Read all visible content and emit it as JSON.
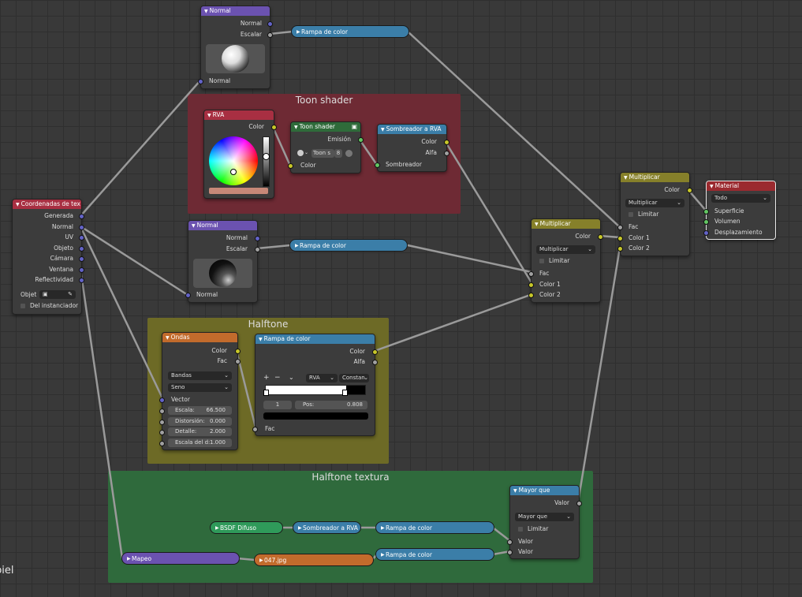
{
  "frames": {
    "toon": {
      "title": "Toon shader",
      "color": "#6e2a34"
    },
    "halftone": {
      "title": "Halftone",
      "color": "#6d6a26"
    },
    "halftone_tex": {
      "title": "Halftone textura",
      "color": "#2f6a3c"
    }
  },
  "normal_top": {
    "title": "Normal",
    "out_normal": "Normal",
    "out_scalar": "Escalar",
    "in_normal": "Normal"
  },
  "normal_mid": {
    "title": "Normal",
    "out_normal": "Normal",
    "out_scalar": "Escalar",
    "in_normal": "Normal"
  },
  "ramp_pills": {
    "r1": "Rampa de color",
    "r2": "Rampa de color",
    "r3": "Rampa de color",
    "r4": "Rampa de color"
  },
  "rva": {
    "title": "RVA",
    "out": "Color"
  },
  "toon_node": {
    "title": "Toon shader",
    "out": "Emisión",
    "mode": "Toon s",
    "value": "8",
    "in": "Color"
  },
  "shader_rgb": {
    "title": "Sombreador a RVA",
    "out_color": "Color",
    "out_alpha": "Alfa",
    "in": "Sombreador"
  },
  "texcoord": {
    "title": "Coordenadas de tex",
    "outputs": [
      "Generada",
      "Normal",
      "UV",
      "Objeto",
      "Cámara",
      "Ventana",
      "Reflectividad"
    ],
    "object_label": "Objet",
    "instancer": "Del instanciador"
  },
  "mult1": {
    "title": "Multiplicar",
    "out": "Color",
    "mode": "Multiplicar",
    "clamp": "Limitar",
    "in_fac": "Fac",
    "in_c1": "Color 1",
    "in_c2": "Color 2"
  },
  "mult2": {
    "title": "Multiplicar",
    "out": "Color",
    "mode": "Multiplicar",
    "clamp": "Limitar",
    "in_fac": "Fac",
    "in_c1": "Color 1",
    "in_c2": "Color 2"
  },
  "material": {
    "title": "Material",
    "target": "Todo",
    "inputs": [
      "Superficie",
      "Volumen",
      "Desplazamiento"
    ]
  },
  "waves": {
    "title": "Ondas",
    "out_color": "Color",
    "out_fac": "Fac",
    "type": "Bandas",
    "profile": "Seno",
    "in_vector": "Vector",
    "fields": [
      {
        "label": "Escala:",
        "value": "66.500"
      },
      {
        "label": "Distorsión:",
        "value": "0.000"
      },
      {
        "label": "Detalle:",
        "value": "2.000"
      },
      {
        "label": "Escala del d:",
        "value": "1.000"
      }
    ]
  },
  "ramp_node": {
    "title": "Rampa de color",
    "out_color": "Color",
    "out_alpha": "Alfa",
    "plus": "+",
    "minus": "−",
    "mode": "RVA",
    "interp": "Constan",
    "index": "1",
    "pos_label": "Pos:",
    "pos_value": "0.808",
    "in_fac": "Fac"
  },
  "greater": {
    "title": "Mayor que",
    "out": "Valor",
    "mode": "Mayor que",
    "clamp": "Limitar",
    "in1": "Valor",
    "in2": "Valor"
  },
  "bsdf": {
    "label": "BSDF Difuso"
  },
  "shader_rgb2": {
    "label": "Sombreador a RVA"
  },
  "mapping": {
    "label": "Mapeo"
  },
  "image": {
    "label": "047.jpg"
  },
  "corner_text": "piel",
  "colors": {
    "vector_header": "#6b52b0",
    "input_header": "#a82f42",
    "shader_header": "#2f6b3a",
    "converter_header": "#3b7ea8",
    "color_header": "#86802a",
    "texture_header": "#c26b2c",
    "output_header": "#9b2a2f"
  }
}
